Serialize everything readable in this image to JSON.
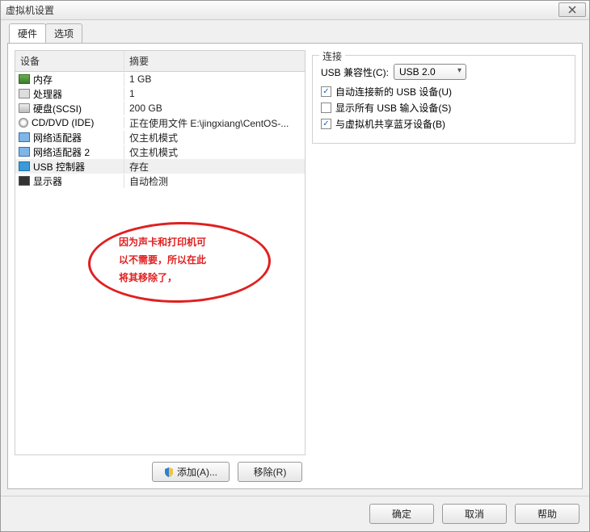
{
  "window": {
    "title": "虚拟机设置"
  },
  "tabs": {
    "hardware": "硬件",
    "options": "选项"
  },
  "hwtable": {
    "col_device": "设备",
    "col_summary": "摘要",
    "rows": [
      {
        "icon": "i-mem",
        "name": "内存",
        "summary": "1 GB"
      },
      {
        "icon": "i-cpu",
        "name": "处理器",
        "summary": "1"
      },
      {
        "icon": "i-disk",
        "name": "硬盘(SCSI)",
        "summary": "200 GB"
      },
      {
        "icon": "i-cd",
        "name": "CD/DVD (IDE)",
        "summary": "正在使用文件 E:\\jingxiang\\CentOS-..."
      },
      {
        "icon": "i-net",
        "name": "网络适配器",
        "summary": "仅主机模式"
      },
      {
        "icon": "i-net",
        "name": "网络适配器 2",
        "summary": "仅主机模式"
      },
      {
        "icon": "i-usb",
        "name": "USB 控制器",
        "summary": "存在"
      },
      {
        "icon": "i-disp",
        "name": "显示器",
        "summary": "自动检测"
      }
    ],
    "selected_index": 6
  },
  "annotation": {
    "line1": "因为声卡和打印机可",
    "line2": "以不需要，所以在此",
    "line3": "将其移除了，"
  },
  "left_buttons": {
    "add": "添加(A)...",
    "remove": "移除(R)"
  },
  "right": {
    "group_title": "连接",
    "compat_label": "USB 兼容性(C):",
    "compat_value": "USB 2.0",
    "chk_auto": {
      "checked": true,
      "label": "自动连接新的 USB 设备(U)"
    },
    "chk_show": {
      "checked": false,
      "label": "显示所有 USB 输入设备(S)"
    },
    "chk_bt": {
      "checked": true,
      "label": "与虚拟机共享蓝牙设备(B)"
    }
  },
  "footer": {
    "ok": "确定",
    "cancel": "取消",
    "help": "帮助"
  }
}
